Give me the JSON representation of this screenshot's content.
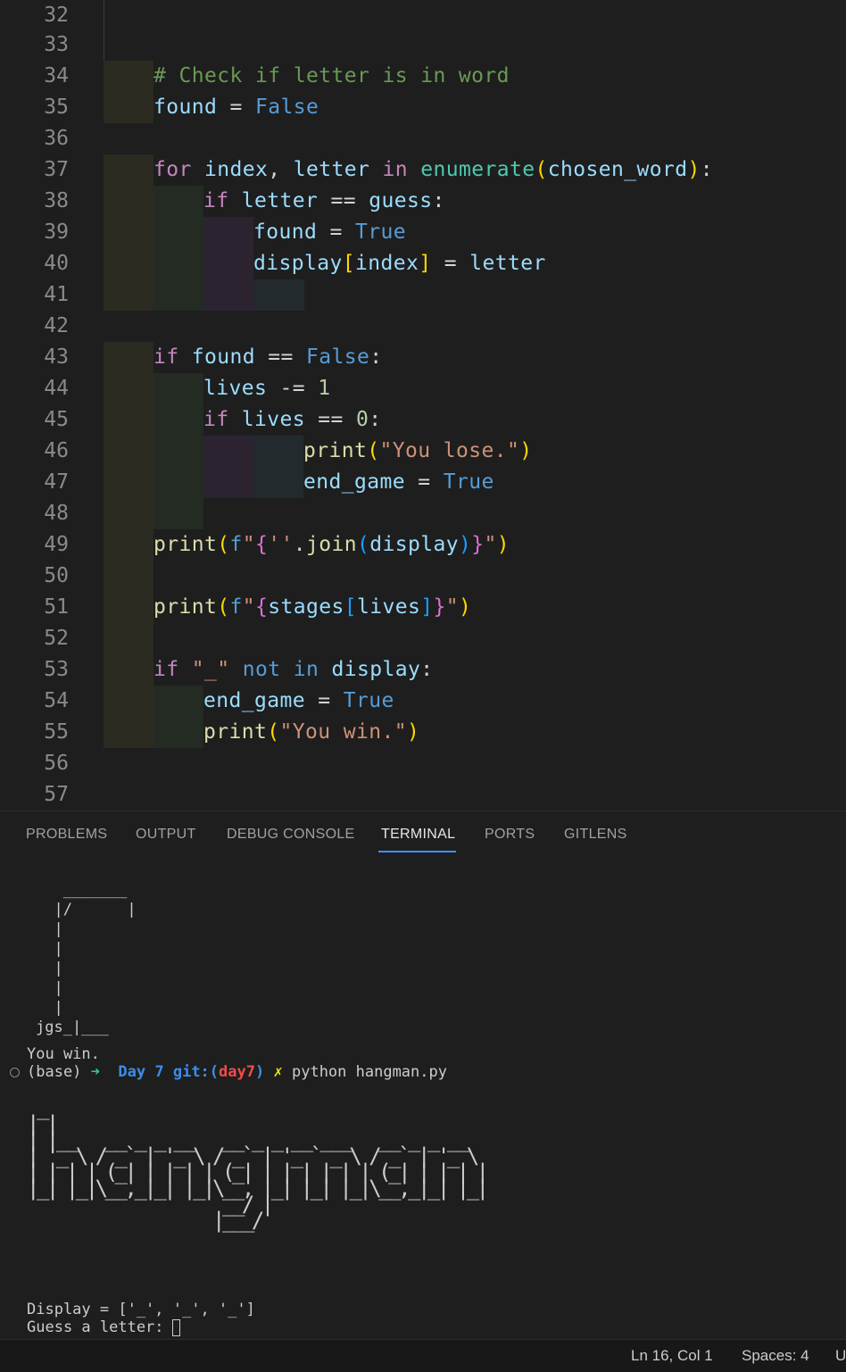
{
  "editor": {
    "lines": [
      {
        "n": "32"
      },
      {
        "n": "33"
      },
      {
        "n": "34",
        "text": "# Check if letter is in word"
      },
      {
        "n": "35"
      },
      {
        "n": "36"
      },
      {
        "n": "37"
      },
      {
        "n": "38"
      },
      {
        "n": "39"
      },
      {
        "n": "40"
      },
      {
        "n": "41"
      },
      {
        "n": "42"
      },
      {
        "n": "43"
      },
      {
        "n": "44"
      },
      {
        "n": "45"
      },
      {
        "n": "46"
      },
      {
        "n": "47"
      },
      {
        "n": "48"
      },
      {
        "n": "49"
      },
      {
        "n": "50"
      },
      {
        "n": "51"
      },
      {
        "n": "52"
      },
      {
        "n": "53"
      },
      {
        "n": "54"
      },
      {
        "n": "55"
      },
      {
        "n": "56"
      },
      {
        "n": "57"
      }
    ],
    "tokens": {
      "found": "found",
      "eq": "=",
      "false": "False",
      "true": "True",
      "for": "for",
      "index": "index",
      "comma": ",",
      "letter": "letter",
      "in": "in",
      "enumerate": "enumerate",
      "lparen": "(",
      "rparen": ")",
      "chosen_word": "chosen_word",
      "colon": ":",
      "if": "if",
      "eqeq": "==",
      "guess": "guess",
      "display": "display",
      "lbrack": "[",
      "rbrack": "]",
      "lives": "lives",
      "minuseq": "-=",
      "one": "1",
      "zero": "0",
      "print": "print",
      "you_lose": "\"You lose.\"",
      "end_game": "end_game",
      "f": "f",
      "q": "\"",
      "lbrace": "{",
      "rbrace": "}",
      "empty_str": "''",
      "dot": ".",
      "join": "join",
      "stages": "stages",
      "underscore_str": "\"_\"",
      "not": "not",
      "you_win": "\"You win.\""
    }
  },
  "panel": {
    "tabs": [
      {
        "label": "PROBLEMS"
      },
      {
        "label": "OUTPUT"
      },
      {
        "label": "DEBUG CONSOLE"
      },
      {
        "label": "TERMINAL",
        "active": true
      },
      {
        "label": "PORTS"
      },
      {
        "label": "GITLENS"
      }
    ]
  },
  "terminal": {
    "gallows_art": "   _______\n  |/      |\n  |\n  |\n  |\n  |\n  |\njgs_|___",
    "result": "You win.",
    "prompt": {
      "env": "(base)",
      "arrow": "➜",
      "dir": "Day 7",
      "git_label": "git:(",
      "branch": "day7",
      "git_close": ")",
      "dirty_mark": "✗",
      "command": "python hangman.py"
    },
    "logo_art": " _\n| |\n| |__   __ _ _ __   __ _ _ __ ___   __ _ _ __\n| '_ \\ / _` | '_ \\ / _` | '_ ` _ \\ / _` | '_ \\\n| | | | (_| | | | | (_| | | | | | | (_| | | | |\n|_| |_|\\__,_|_| |_|\\__, |_| |_| |_|\\__,_|_| |_|\n                    __/ |\n                   |___/",
    "display_line": "Display = ['_', '_', '_']",
    "guess_prompt": "Guess a letter: "
  },
  "status_bar": {
    "position": "Ln 16, Col 1",
    "spaces": "Spaces: 4",
    "encoding_partial": "U"
  }
}
